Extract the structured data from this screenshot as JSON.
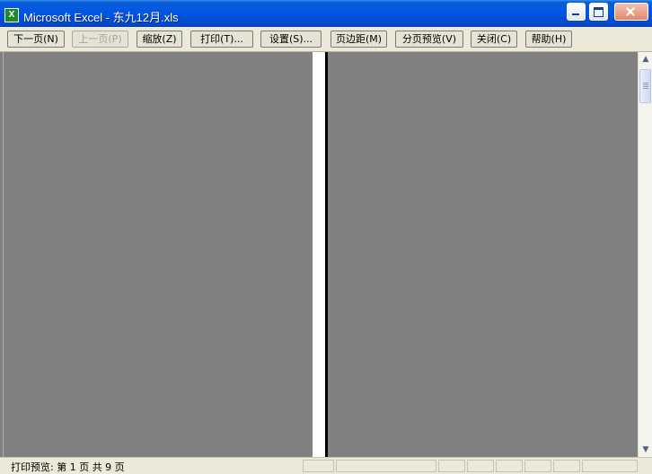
{
  "window": {
    "title": "Microsoft Excel - 东九12月.xls",
    "app_icon_glyph": "X",
    "icon": "excel-icon"
  },
  "toolbar": {
    "buttons": [
      {
        "label": "下一页(N)",
        "enabled": true
      },
      {
        "label": "上一页(P)",
        "enabled": false
      },
      {
        "label": "缩放(Z)",
        "enabled": true
      },
      {
        "label": "打印(T)...",
        "enabled": true
      },
      {
        "label": "设置(S)...",
        "enabled": true
      },
      {
        "label": "页边距(M)",
        "enabled": true
      },
      {
        "label": "分页预览(V)",
        "enabled": true
      },
      {
        "label": "关闭(C)",
        "enabled": true
      },
      {
        "label": "帮助(H)",
        "enabled": true
      }
    ]
  },
  "scrollbar": {
    "up_arrow": "▲",
    "down_arrow": "▼"
  },
  "status": {
    "text": "打印预览: 第 1 页  共 9 页"
  },
  "colors": {
    "preview_background": "#808080",
    "titlebar": "#0055e5",
    "toolbar": "#ece9d8"
  }
}
